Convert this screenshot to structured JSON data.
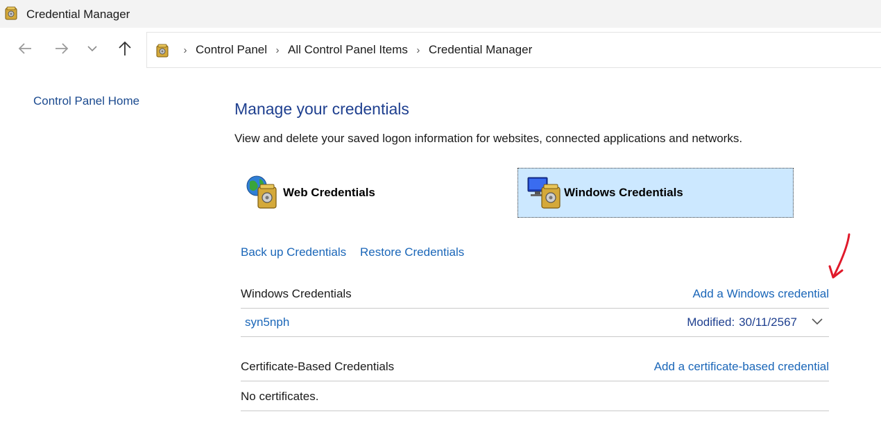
{
  "window": {
    "title": "Credential Manager"
  },
  "nav": {
    "back_icon": "arrow-left-icon",
    "forward_icon": "arrow-right-icon",
    "recent_icon": "chevron-down-icon",
    "up_icon": "arrow-up-icon",
    "breadcrumb": [
      "Control Panel",
      "All Control Panel Items",
      "Credential Manager"
    ]
  },
  "left_pane": {
    "home_link": "Control Panel Home"
  },
  "main": {
    "heading": "Manage your credentials",
    "description": "View and delete your saved logon information for websites, connected applications and networks.",
    "tabs": {
      "web": "Web Credentials",
      "windows": "Windows Credentials",
      "selected": "windows"
    },
    "backup_link": "Back up Credentials",
    "restore_link": "Restore Credentials",
    "windows_section": {
      "title": "Windows Credentials",
      "action": "Add a Windows credential",
      "items": [
        {
          "name": "syn5nph",
          "modified_label": "Modified:",
          "modified_value": "30/11/2567"
        }
      ]
    },
    "certificate_section": {
      "title": "Certificate-Based Credentials",
      "action": "Add a certificate-based credential",
      "empty_text": "No certificates."
    }
  },
  "colors": {
    "link": "#1a66b8",
    "heading": "#1e3f8f",
    "selected_tab_bg": "#cce8ff",
    "annotation": "#e0192a"
  }
}
